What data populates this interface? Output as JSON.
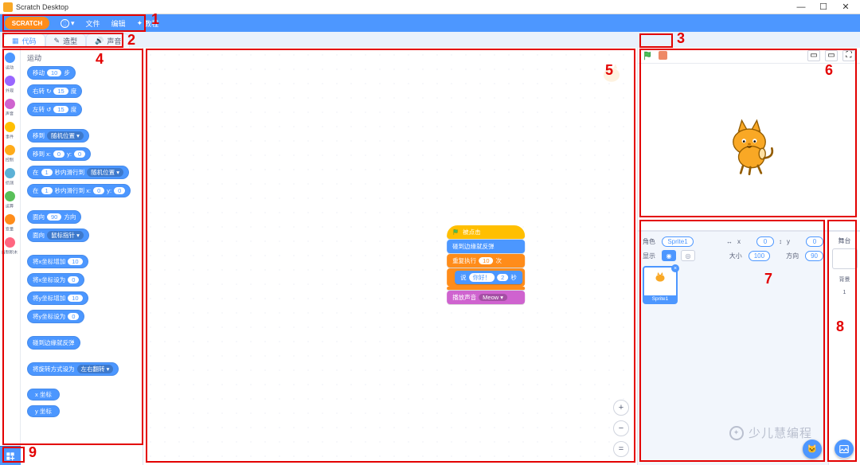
{
  "app": {
    "title": "Scratch Desktop"
  },
  "window": {
    "min": "—",
    "max": "☐",
    "close": "✕"
  },
  "menubar": {
    "logo": "SCRATCH",
    "globe_dd": "▾",
    "file": "文件",
    "edit": "编辑",
    "tutorials_icon": "✦",
    "tutorials": "教程"
  },
  "tabs": {
    "code_icon": "▦",
    "code": "代码",
    "costumes_icon": "✎",
    "costumes": "造型",
    "sounds_icon": "🔊",
    "sounds": "声音"
  },
  "categories": [
    {
      "label": "运动",
      "color": "#4c97ff"
    },
    {
      "label": "外观",
      "color": "#9966ff"
    },
    {
      "label": "声音",
      "color": "#cf63cf"
    },
    {
      "label": "事件",
      "color": "#ffbf00"
    },
    {
      "label": "控制",
      "color": "#ffab19"
    },
    {
      "label": "侦测",
      "color": "#5cb1d6"
    },
    {
      "label": "运算",
      "color": "#59c059"
    },
    {
      "label": "变量",
      "color": "#ff8c1a"
    },
    {
      "label": "自制积木",
      "color": "#ff6680"
    }
  ],
  "palette": {
    "heading": "运动",
    "blocks": {
      "move_a": "移动",
      "move_v": "10",
      "move_b": "步",
      "turnr_a": "右转 ↻",
      "turnr_v": "15",
      "turnr_b": "度",
      "turnl_a": "左转 ↺",
      "turnl_v": "15",
      "turnl_b": "度",
      "goto_a": "移到",
      "goto_dd": "随机位置 ▾",
      "gotoxy_a": "移到 x:",
      "gotoxy_x": "0",
      "gotoxy_m": "y:",
      "gotoxy_y": "0",
      "glide1_a": "在",
      "glide1_s": "1",
      "glide1_b": "秒内滑行到",
      "glide1_dd": "随机位置 ▾",
      "glide2_a": "在",
      "glide2_s": "1",
      "glide2_b": "秒内滑行到 x:",
      "glide2_x": "0",
      "glide2_m": "y:",
      "glide2_y": "0",
      "point_a": "面向",
      "point_v": "90",
      "point_b": "方向",
      "ptow_a": "面向",
      "ptow_dd": "鼠标指针 ▾",
      "chx_a": "将x坐标增加",
      "chx_v": "10",
      "setx_a": "将x坐标设为",
      "setx_v": "0",
      "chy_a": "将y坐标增加",
      "chy_v": "10",
      "sety_a": "将y坐标设为",
      "sety_v": "0",
      "bounce": "碰到边缘就反弹",
      "rotstyle_a": "将旋转方式设为",
      "rotstyle_dd": "左右翻转 ▾",
      "reporter_x": "x 坐标",
      "reporter_y": "y 坐标"
    }
  },
  "script": {
    "hat": "被点击",
    "forever": "碰到边缘就反弹",
    "repeat_a": "重复执行",
    "repeat_n": "10",
    "repeat_b": "次",
    "say_a": "说",
    "say_t": "你好！",
    "say_n": "2",
    "say_b": "秒",
    "sound_a": "播放声音",
    "sound_dd": "Meow ▾"
  },
  "stage_controls": {
    "small": "▭",
    "large": "▭",
    "full": "⛶"
  },
  "zoom": {
    "in": "+",
    "out": "−",
    "reset": "="
  },
  "sprite_panel": {
    "name_lbl": "角色",
    "name_val": "Sprite1",
    "x_lbl": "x",
    "x_val": "0",
    "y_lbl": "y",
    "y_val": "0",
    "show_lbl": "显示",
    "size_lbl": "大小",
    "size_val": "100",
    "dir_lbl": "方向",
    "dir_val": "90",
    "thumb_label": "Sprite1",
    "thumb_close": "×"
  },
  "stage_panel": {
    "title": "舞台",
    "backdrops_lbl": "背景",
    "backdrops_n": "1"
  },
  "annotations": {
    "n1": "1",
    "n2": "2",
    "n3": "3",
    "n4": "4",
    "n5": "5",
    "n6": "6",
    "n7": "7",
    "n8": "8",
    "n9": "9"
  },
  "watermark": "少儿慧编程",
  "icons": {
    "arrow_lr": "↔",
    "arrow_ud": "↕",
    "eye": "◉",
    "eye_off": "◎",
    "cat_face": "🐱"
  }
}
